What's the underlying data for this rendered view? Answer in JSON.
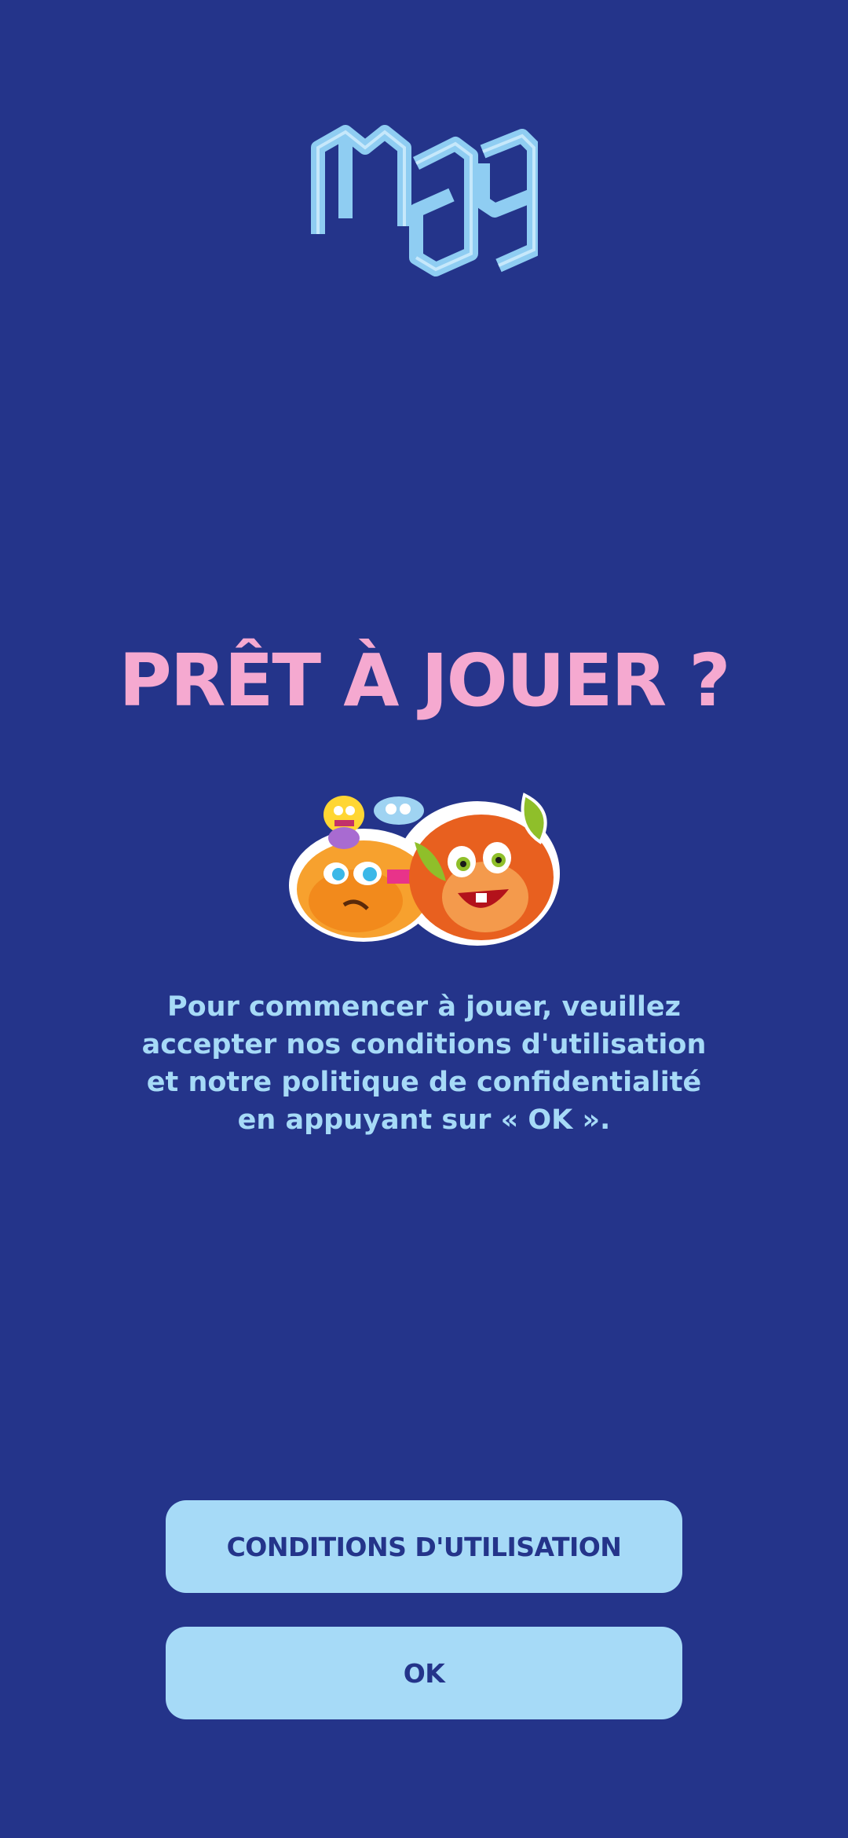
{
  "app": {
    "logo_alt": "logo",
    "background_color": "#24348a"
  },
  "main": {
    "title": "PRÊT À JOUER ?",
    "title_color": "#f5a9d0",
    "illustration": "game-mascots-illustration",
    "message": "Pour commencer à jouer, veuillez\naccepter nos conditions d'utilisation\net notre politique de confidentialité\nen appuyant sur « OK ».",
    "message_color": "#a6daf7"
  },
  "buttons": {
    "terms_label": "CONDITIONS D'UTILISATION",
    "ok_label": "OK",
    "button_color": "#a6daf7",
    "button_text_color": "#24348a"
  }
}
